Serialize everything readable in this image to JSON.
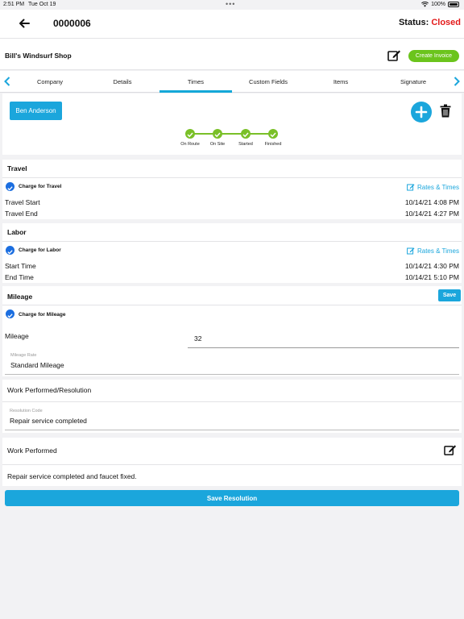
{
  "status_bar": {
    "time": "2:51 PM",
    "date": "Tue Oct 19",
    "battery": "100%"
  },
  "header": {
    "job_number": "0000006",
    "status_label": "Status:",
    "status_value": "Closed"
  },
  "subheader": {
    "customer": "Bill's Windsurf Shop",
    "create_invoice": "Create Invoice"
  },
  "tabs": [
    {
      "label": "Company"
    },
    {
      "label": "Details"
    },
    {
      "label": "Times"
    },
    {
      "label": "Custom Fields"
    },
    {
      "label": "Items"
    },
    {
      "label": "Signature"
    }
  ],
  "active_tab": "Times",
  "technician": {
    "name": "Ben Anderson"
  },
  "progress_steps": [
    {
      "label": "On Route"
    },
    {
      "label": "On Site"
    },
    {
      "label": "Started"
    },
    {
      "label": "Finished"
    }
  ],
  "travel": {
    "title": "Travel",
    "charge_label": "Charge for Travel",
    "rates_link": "Rates & Times",
    "start_label": "Travel Start",
    "start_value": "10/14/21 4:08 PM",
    "end_label": "Travel End",
    "end_value": "10/14/21 4:27 PM"
  },
  "labor": {
    "title": "Labor",
    "charge_label": "Charge for Labor",
    "rates_link": "Rates & Times",
    "start_label": "Start Time",
    "start_value": "10/14/21 4:30 PM",
    "end_label": "End Time",
    "end_value": "10/14/21 5:10 PM"
  },
  "mileage": {
    "title": "Mileage",
    "save_label": "Save",
    "charge_label": "Charge for Mileage",
    "mileage_label": "Mileage",
    "mileage_value": "32",
    "rate_label": "Mileage Rate",
    "rate_value": "Standard Mileage"
  },
  "resolution": {
    "title": "Work Performed/Resolution",
    "code_label": "Resolution Code",
    "code_value": "Repair service completed"
  },
  "work_performed": {
    "title": "Work Performed",
    "text": "Repair service completed and faucet fixed.",
    "save_label": "Save Resolution"
  },
  "colors": {
    "accent": "#1ba6dc",
    "success": "#7ac028",
    "danger": "#e31b1b",
    "check": "#1b6ee0"
  }
}
